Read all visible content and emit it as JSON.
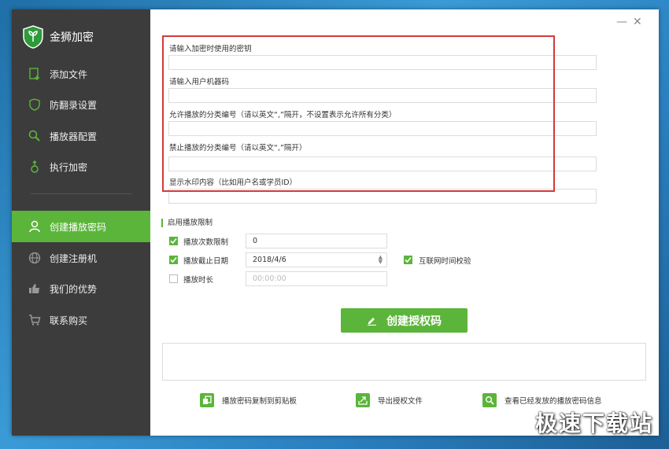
{
  "app": {
    "title": "金狮加密"
  },
  "sidebar": {
    "items": [
      {
        "label": "添加文件",
        "icon": "add-file-icon"
      },
      {
        "label": "防翻录设置",
        "icon": "shield-icon"
      },
      {
        "label": "播放器配置",
        "icon": "search-icon"
      },
      {
        "label": "执行加密",
        "icon": "run-icon"
      },
      {
        "label": "创建播放密码",
        "icon": "user-icon",
        "active": true
      },
      {
        "label": "创建注册机",
        "icon": "globe-icon"
      },
      {
        "label": "我们的优势",
        "icon": "thumbs-up-icon"
      },
      {
        "label": "联系购买",
        "icon": "cart-icon"
      }
    ]
  },
  "window": {
    "minimize": "—",
    "close": "✕"
  },
  "form": {
    "fields": [
      {
        "label": "请输入加密时使用的密钥",
        "value": ""
      },
      {
        "label": "请输入用户机器码",
        "value": ""
      },
      {
        "label": "允许播放的分类编号（请以英文“,”隔开，不设置表示允许所有分类）",
        "value": ""
      },
      {
        "label": "禁止播放的分类编号（请以英文“,”隔开）",
        "value": ""
      },
      {
        "label": "显示水印内容（比如用户名或学员ID）",
        "value": ""
      }
    ]
  },
  "limits": {
    "section_title": "启用播放限制",
    "play_count": {
      "label": "播放次数限制",
      "checked": true,
      "value": "0"
    },
    "end_date": {
      "label": "播放截止日期",
      "checked": true,
      "value": "2018/4/6"
    },
    "internet_check": {
      "label": "互联网时间校验",
      "checked": true
    },
    "duration": {
      "label": "播放时长",
      "checked": false,
      "placeholder": "00:00:00"
    }
  },
  "actions": {
    "create_label": "创建授权码",
    "copy_label": "播放密码复制到剪贴板",
    "export_label": "导出授权文件",
    "view_label": "查看已经发放的播放密码信息"
  },
  "watermark": "极速下载站",
  "colors": {
    "accent": "#5bb53a",
    "sidebar": "#3c3c3c",
    "highlight_box": "#d33a3a"
  }
}
